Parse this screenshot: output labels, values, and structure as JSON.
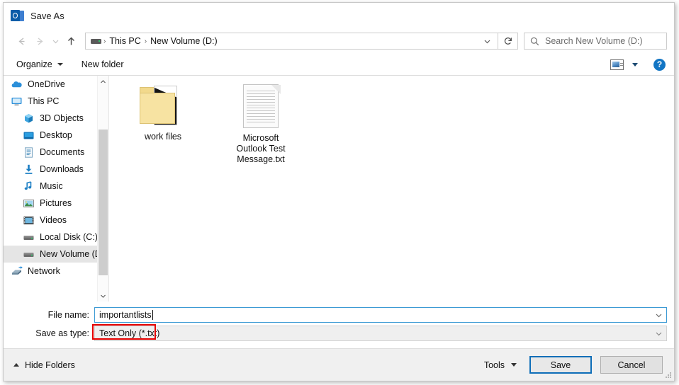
{
  "window": {
    "title": "Save As",
    "app_icon": "outlook-icon"
  },
  "nav": {
    "back_icon": "back-arrow-icon",
    "forward_icon": "forward-arrow-icon",
    "recent_icon": "chevron-down-icon",
    "up_icon": "up-arrow-icon",
    "breadcrumb": {
      "drive_icon": "drive-icon",
      "items": [
        "This PC",
        "New Volume (D:)"
      ],
      "separator": "›",
      "dropdown_icon": "chevron-down-icon"
    },
    "refresh_icon": "refresh-icon"
  },
  "search": {
    "icon": "search-icon",
    "placeholder": "Search New Volume (D:)",
    "value": ""
  },
  "commandbar": {
    "organize_label": "Organize",
    "new_folder_label": "New folder",
    "view_icon": "view-layout-icon",
    "view_caret_icon": "chevron-down-icon",
    "help_label": "?",
    "help_icon": "help-icon"
  },
  "sidebar": {
    "items": [
      {
        "label": "OneDrive",
        "icon": "cloud-icon",
        "level": 0,
        "selected": false
      },
      {
        "label": "This PC",
        "icon": "monitor-icon",
        "level": 0,
        "selected": false
      },
      {
        "label": "3D Objects",
        "icon": "cube-icon",
        "level": 1,
        "selected": false
      },
      {
        "label": "Desktop",
        "icon": "desktop-icon",
        "level": 1,
        "selected": false
      },
      {
        "label": "Documents",
        "icon": "documents-icon",
        "level": 1,
        "selected": false
      },
      {
        "label": "Downloads",
        "icon": "download-icon",
        "level": 1,
        "selected": false
      },
      {
        "label": "Music",
        "icon": "music-icon",
        "level": 1,
        "selected": false
      },
      {
        "label": "Pictures",
        "icon": "pictures-icon",
        "level": 1,
        "selected": false
      },
      {
        "label": "Videos",
        "icon": "videos-icon",
        "level": 1,
        "selected": false
      },
      {
        "label": "Local Disk (C:)",
        "icon": "drive-icon",
        "level": 1,
        "selected": false
      },
      {
        "label": "New Volume (D:",
        "icon": "drive-icon",
        "level": 1,
        "selected": true
      },
      {
        "label": "Network",
        "icon": "network-icon",
        "level": 0,
        "selected": false
      }
    ],
    "scroll_up_icon": "chevron-up-icon",
    "scroll_down_icon": "chevron-down-icon"
  },
  "files": [
    {
      "name": "work files",
      "type": "folder"
    },
    {
      "name": "Microsoft Outlook Test Message.txt",
      "type": "text-document"
    }
  ],
  "fields": {
    "filename_label": "File name:",
    "filename_value": "importantlists",
    "savetype_label": "Save as type:",
    "savetype_value": "Text Only (*.txt)",
    "dropdown_icon": "chevron-down-icon",
    "highlight_color": "#e50000"
  },
  "footer": {
    "hide_folders_label": "Hide Folders",
    "hide_folders_icon": "chevron-up-icon",
    "tools_label": "Tools",
    "tools_icon": "chevron-down-icon",
    "save_label": "Save",
    "cancel_label": "Cancel",
    "focus_color": "#0e6eb8"
  }
}
